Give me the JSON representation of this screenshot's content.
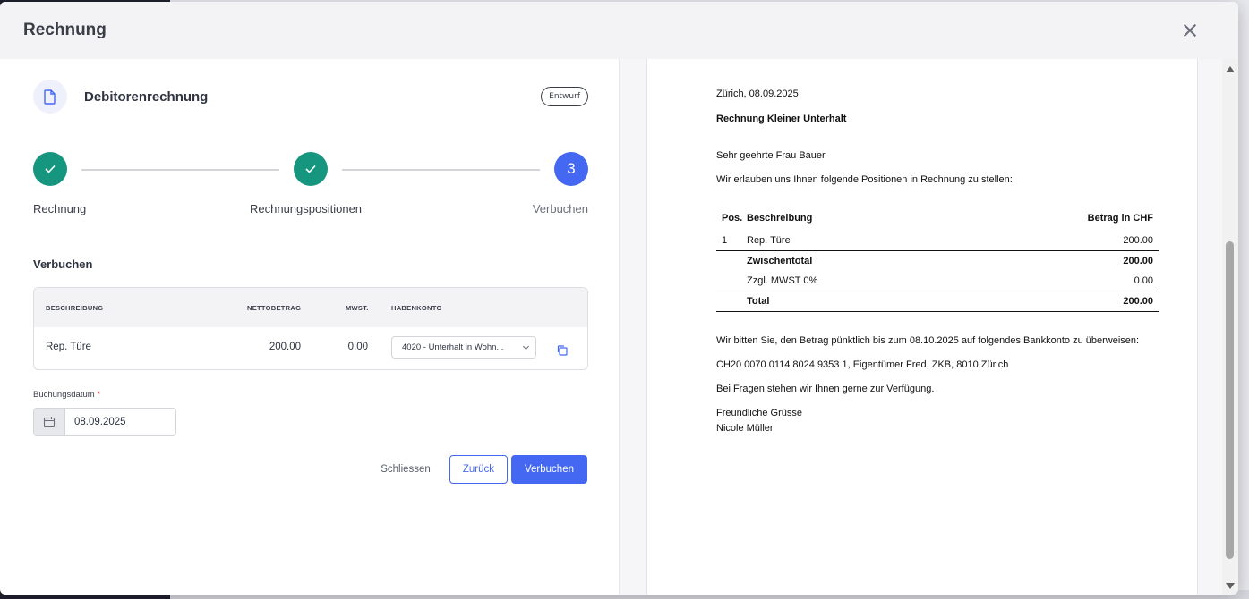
{
  "modal": {
    "title": "Rechnung"
  },
  "header": {
    "doc_title": "Debitorenrechnung",
    "badge": "Entwurf"
  },
  "stepper": {
    "steps": [
      {
        "label": "Rechnung",
        "state": "done"
      },
      {
        "label": "Rechnungspositionen",
        "state": "done"
      },
      {
        "label": "Verbuchen",
        "state": "active",
        "number": "3"
      }
    ]
  },
  "booking": {
    "section_title": "Verbuchen",
    "columns": [
      "BESCHREIBUNG",
      "NETTOBETRAG",
      "MWST.",
      "HABENKONTO"
    ],
    "rows": [
      {
        "description": "Rep. Türe",
        "net": "200.00",
        "vat": "0.00",
        "account": "4020 - Unterhalt in Wohn..."
      }
    ],
    "date_label": "Buchungsdatum",
    "date_required": "*",
    "date_value": "08.09.2025"
  },
  "actions": {
    "close": "Schliessen",
    "back": "Zurück",
    "submit": "Verbuchen"
  },
  "invoice": {
    "place_date": "Zürich, 08.09.2025",
    "subject": "Rechnung Kleiner Unterhalt",
    "salutation": "Sehr geehrte Frau Bauer",
    "intro": "Wir erlauben uns Ihnen folgende Positionen in Rechnung zu stellen:",
    "table": {
      "col_pos": "Pos.",
      "col_desc": "Beschreibung",
      "col_amount": "Betrag in CHF",
      "items": [
        {
          "pos": "1",
          "desc": "Rep. Türe",
          "amount": "200.00"
        }
      ],
      "subtotal_label": "Zwischentotal",
      "subtotal": "200.00",
      "vat_label": "Zzgl. MWST 0%",
      "vat": "0.00",
      "total_label": "Total",
      "total": "200.00"
    },
    "payment_text": "Wir bitten Sie, den Betrag pünktlich bis zum 08.10.2025 auf folgendes Bankkonto zu überweisen:",
    "bank_account": "CH20 0070 0114 8024 9353 1, Eigentümer Fred, ZKB, 8010 Zürich",
    "questions": "Bei Fragen stehen wir Ihnen gerne zur Verfügung.",
    "closing": "Freundliche Grüsse",
    "signature": "Nicole Müller"
  },
  "colors": {
    "primary": "#4468f2",
    "success": "#16967f",
    "required": "#e0303b"
  }
}
